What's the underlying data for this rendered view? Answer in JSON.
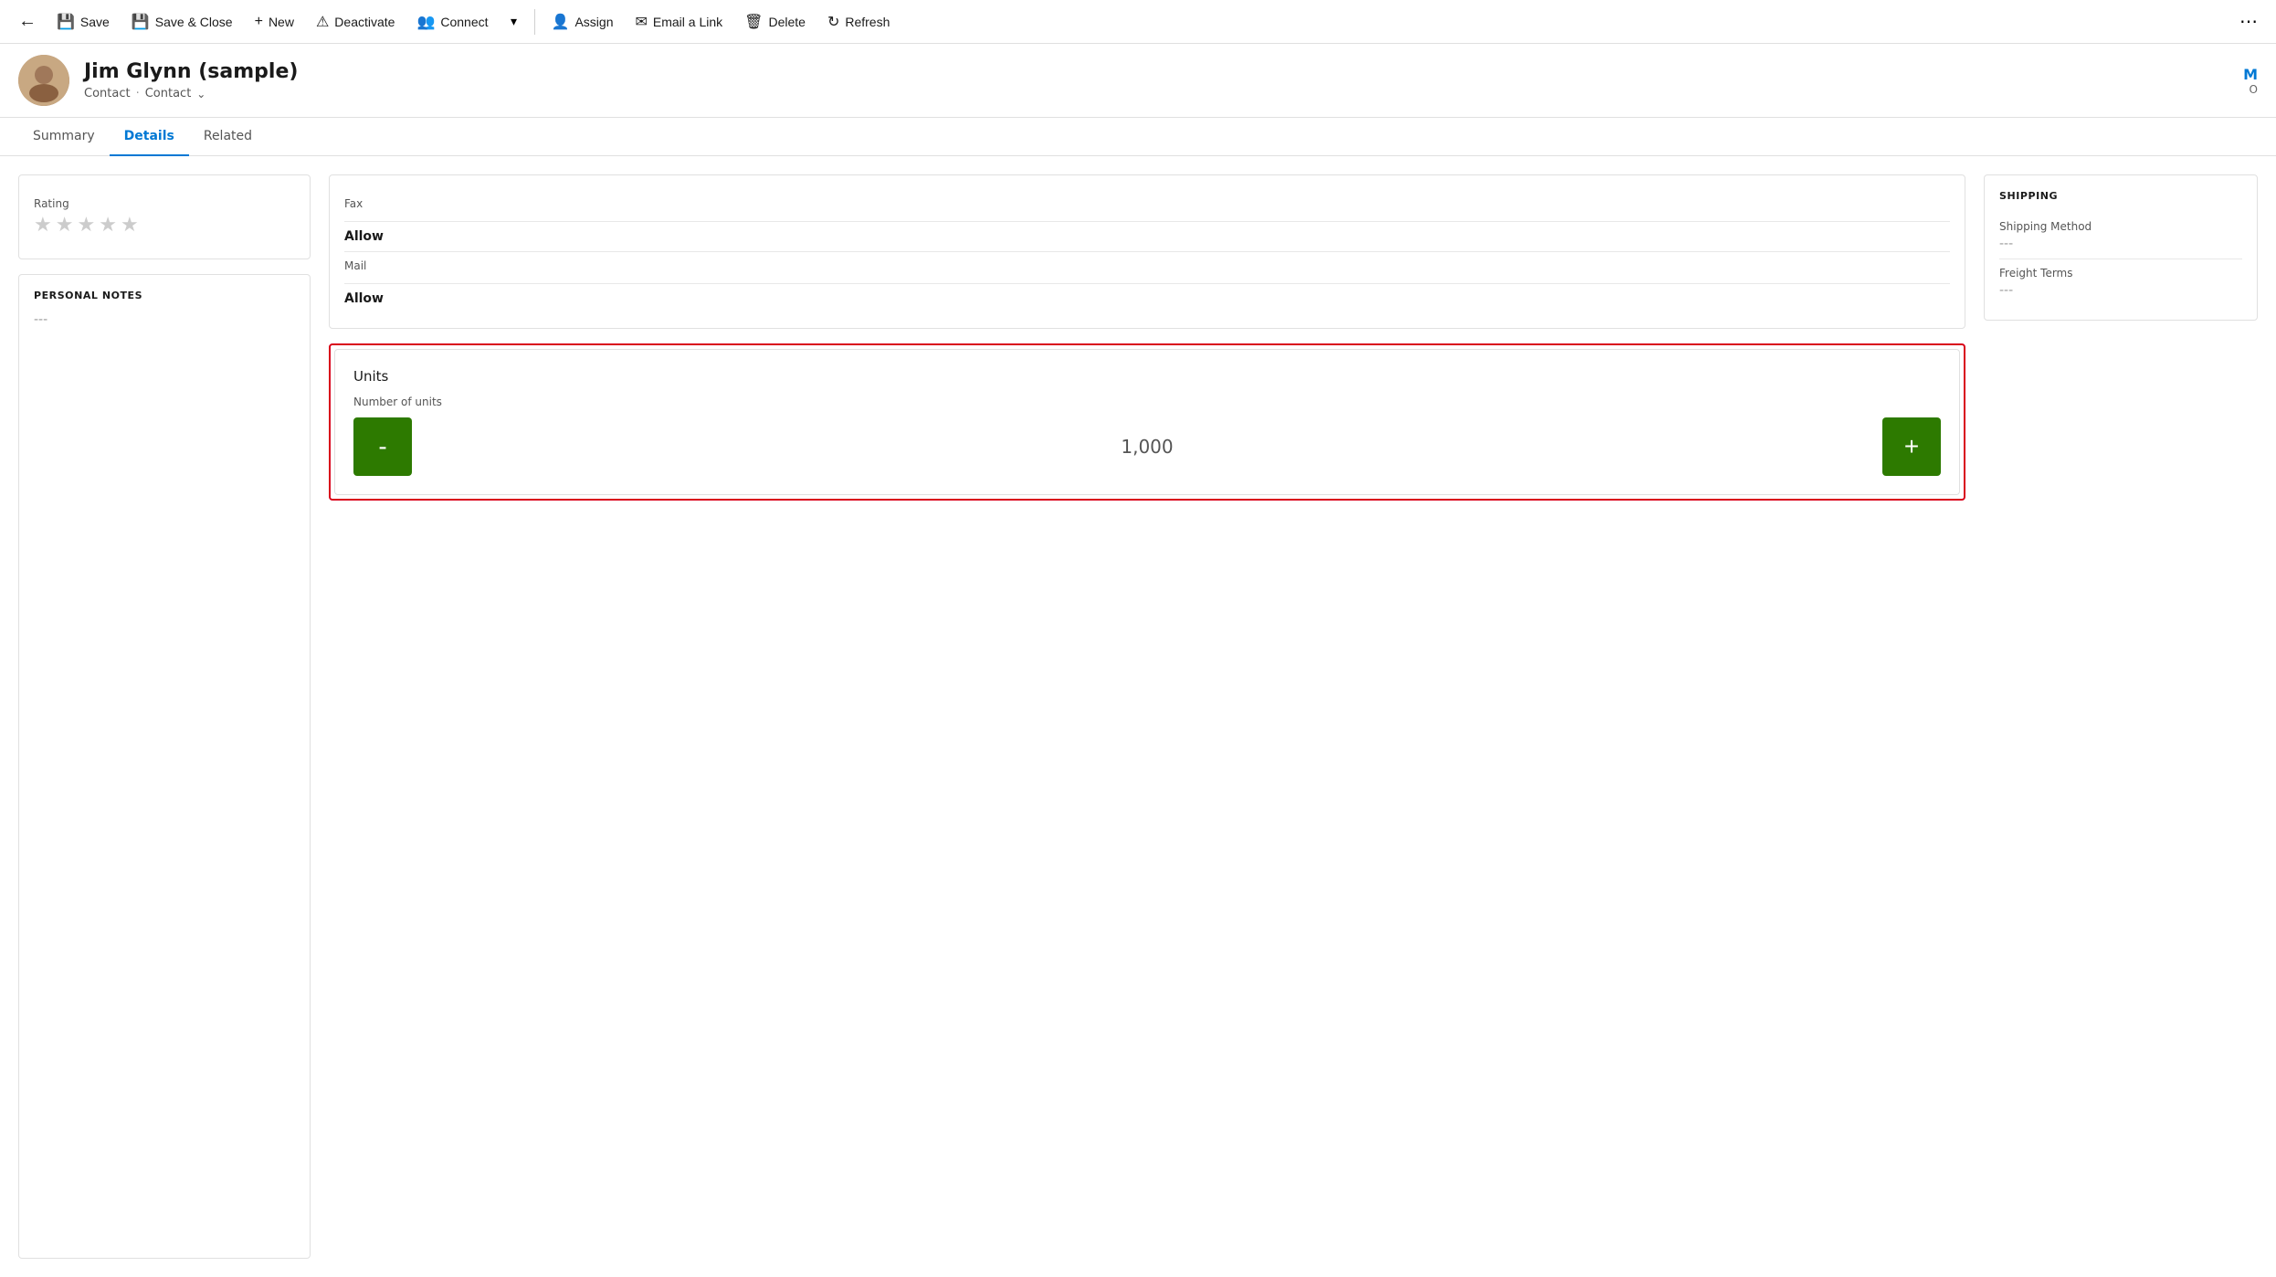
{
  "toolbar": {
    "back_label": "←",
    "save_label": "Save",
    "save_close_label": "Save & Close",
    "new_label": "New",
    "deactivate_label": "Deactivate",
    "connect_label": "Connect",
    "chevron_label": "▾",
    "assign_label": "Assign",
    "email_link_label": "Email a Link",
    "delete_label": "Delete",
    "refresh_label": "Refresh",
    "more_label": "⋯"
  },
  "record": {
    "name": "Jim Glynn (sample)",
    "type1": "Contact",
    "type2": "Contact",
    "header_initial": "M",
    "header_sub": "O"
  },
  "tabs": [
    {
      "id": "summary",
      "label": "Summary",
      "active": false
    },
    {
      "id": "details",
      "label": "Details",
      "active": true
    },
    {
      "id": "related",
      "label": "Related",
      "active": false
    }
  ],
  "left_col": {
    "rating_label": "Rating",
    "stars": [
      false,
      false,
      false,
      false,
      false
    ],
    "personal_notes_title": "PERSONAL NOTES",
    "personal_notes_value": "---"
  },
  "mid_col": {
    "fax_label": "Fax",
    "fax_allow_value": "Allow",
    "mail_label": "Mail",
    "mail_allow_value": "Allow",
    "units_title": "Units",
    "units_number_label": "Number of units",
    "units_value": "1,000",
    "units_minus": "-",
    "units_plus": "+"
  },
  "right_col": {
    "shipping_title": "SHIPPING",
    "shipping_method_label": "Shipping Method",
    "shipping_method_value": "---",
    "freight_terms_label": "Freight Terms",
    "freight_terms_value": "---"
  }
}
